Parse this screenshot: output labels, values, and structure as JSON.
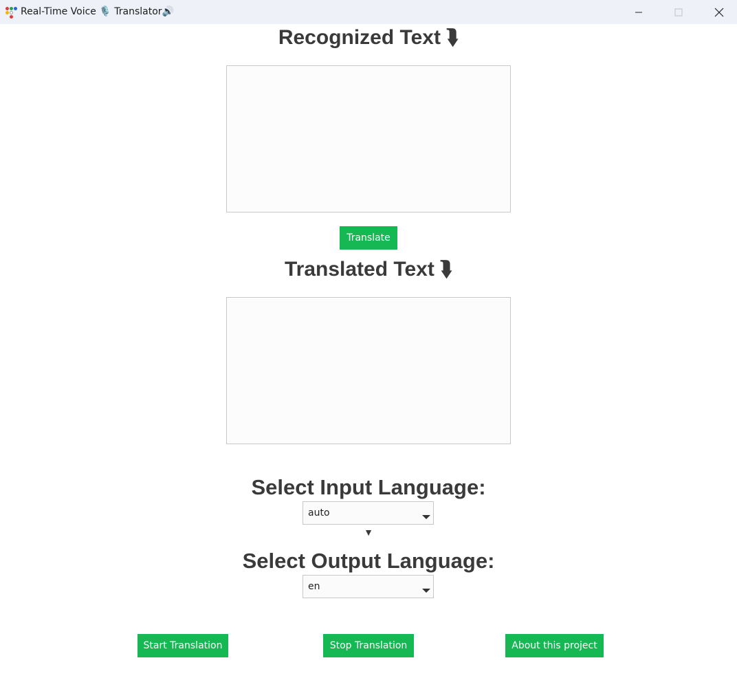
{
  "window": {
    "title": "Real-Time Voice 🎙️ Translator🔊",
    "controls": {
      "minimize": "minimize",
      "maximize": "maximize",
      "close": "close"
    }
  },
  "recognized": {
    "heading": "Recognized Text",
    "arrow": "⮯",
    "value": ""
  },
  "translate_button": "Translate",
  "translated": {
    "heading": "Translated Text",
    "arrow": "⮯",
    "value": ""
  },
  "input_language": {
    "heading": "Select Input Language:",
    "selected": "auto"
  },
  "language_arrow": "▼",
  "output_language": {
    "heading": "Select Output Language:",
    "selected": "en"
  },
  "buttons": {
    "start": "Start Translation",
    "stop": "Stop Translation",
    "about": "About this project"
  },
  "colors": {
    "accent": "#15b852",
    "heading": "#3a3a3a",
    "titlebar": "#eef2f8"
  }
}
